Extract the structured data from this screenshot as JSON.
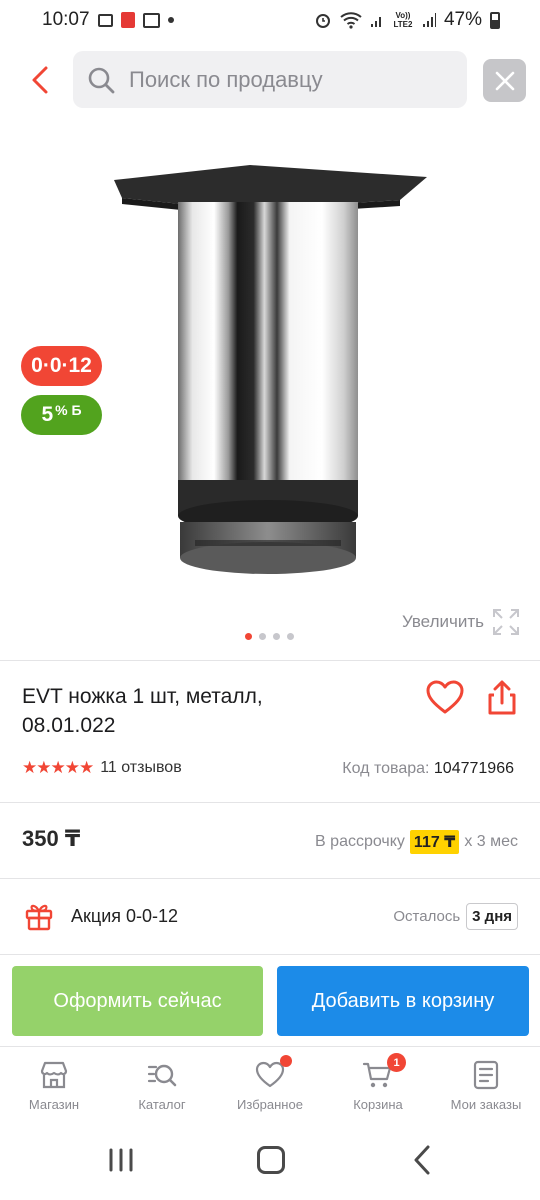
{
  "status_bar": {
    "time": "10:07",
    "volte": "Vo)) LTE2",
    "battery": "47%"
  },
  "search": {
    "placeholder": "Поиск по продавцу"
  },
  "gallery": {
    "badge_installment": "0·0·12",
    "badge_bonus_value": "5",
    "badge_bonus_suffix": "% Б",
    "zoom_label": "Увеличить",
    "dots_count": 4,
    "active_dot": 1
  },
  "product": {
    "title": "EVT ножка 1 шт, металл, 08.01.022",
    "stars": "★★★★★",
    "reviews": "11 отзывов",
    "sku_label": "Код товара:",
    "sku_value": "104771966"
  },
  "price": {
    "value": "350 ₸",
    "installment_label": "В рассрочку",
    "installment_amount": "117 ₸",
    "installment_term": "x 3 мес"
  },
  "promo": {
    "label": "Акция 0-0-12",
    "remaining_label": "Осталось",
    "remaining_value": "3 дня"
  },
  "actions": {
    "buy_now": "Оформить сейчас",
    "add_to_cart": "Добавить в корзину"
  },
  "bottom_nav": {
    "items": [
      {
        "label": "Магазин",
        "icon": "store-icon"
      },
      {
        "label": "Каталог",
        "icon": "catalog-search-icon"
      },
      {
        "label": "Избранное",
        "icon": "heart-icon"
      },
      {
        "label": "Корзина",
        "icon": "cart-icon",
        "badge": "1"
      },
      {
        "label": "Мои заказы",
        "icon": "orders-icon"
      }
    ]
  },
  "colors": {
    "accent_red": "#f14635",
    "bonus_green": "#52a31e",
    "buy_green": "#95d26a",
    "cart_blue": "#1c8be8",
    "installment_yellow": "#ffd200"
  }
}
